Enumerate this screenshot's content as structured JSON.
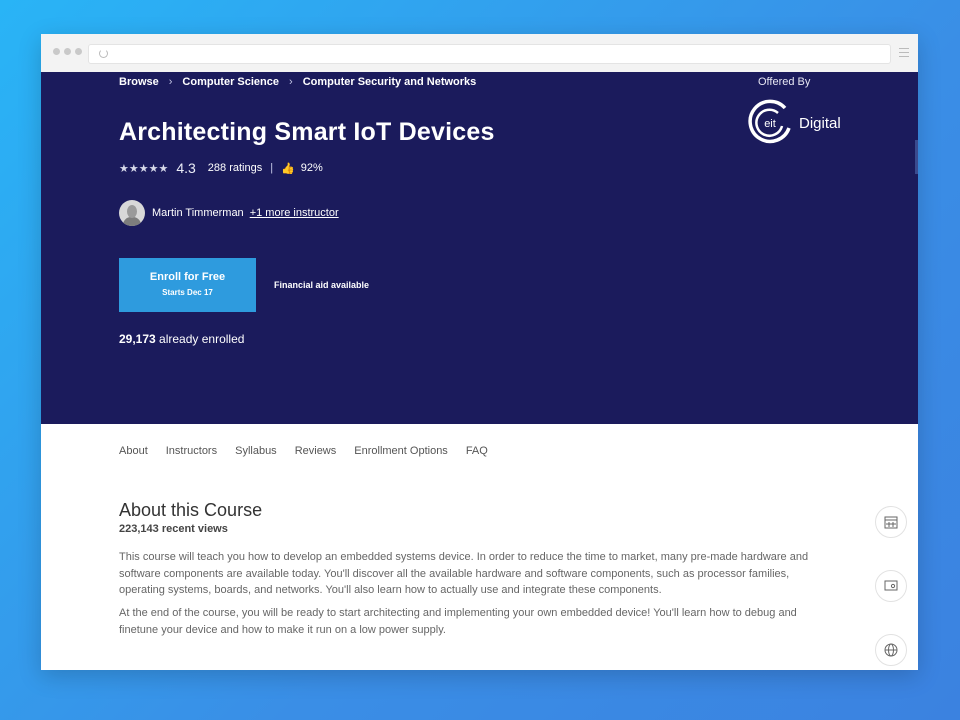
{
  "breadcrumb": [
    "Browse",
    "Computer Science",
    "Computer Security and Networks"
  ],
  "breadcrumb_separator": "›",
  "offered_by": {
    "label": "Offered By",
    "logo_text": "eit",
    "logo_suffix": "Digital"
  },
  "course": {
    "title": "Architecting Smart IoT Devices",
    "stars": "★★★★★",
    "rating": "4.3",
    "ratings_count": "288 ratings",
    "divider": "|",
    "thumb_icon": "👍",
    "recommend_pct": "92%",
    "instructor": "Martin Timmerman",
    "more_instructors": "+1 more instructor",
    "enroll_label": "Enroll for Free",
    "enroll_sub": "Starts Dec 17",
    "financial_aid": "Financial aid available",
    "enrolled_count": "29,173",
    "enrolled_suffix": " already enrolled"
  },
  "tabs": [
    "About",
    "Instructors",
    "Syllabus",
    "Reviews",
    "Enrollment Options",
    "FAQ"
  ],
  "about": {
    "title": "About this Course",
    "views": "223,143 recent views",
    "paragraphs": [
      "This course will teach you how to develop an embedded systems device. In order to reduce the time to market, many pre-made hardware and software components are available today. You'll discover all the available hardware and software components, such as processor families, operating systems, boards, and networks. You'll also learn how to actually use and integrate these components.",
      "At the end of the course, you will be ready to start architecting and implementing your own embedded device! You'll learn how to debug and finetune your device and how to make it run on a low power supply."
    ]
  },
  "side_icons": [
    "calendar-icon",
    "certificate-icon",
    "globe-icon"
  ],
  "colors": {
    "hero_bg": "#1b1b5c",
    "enroll_bg": "#2e9bde",
    "page_bg_start": "#29b4f6",
    "page_bg_end": "#3b82e0"
  }
}
